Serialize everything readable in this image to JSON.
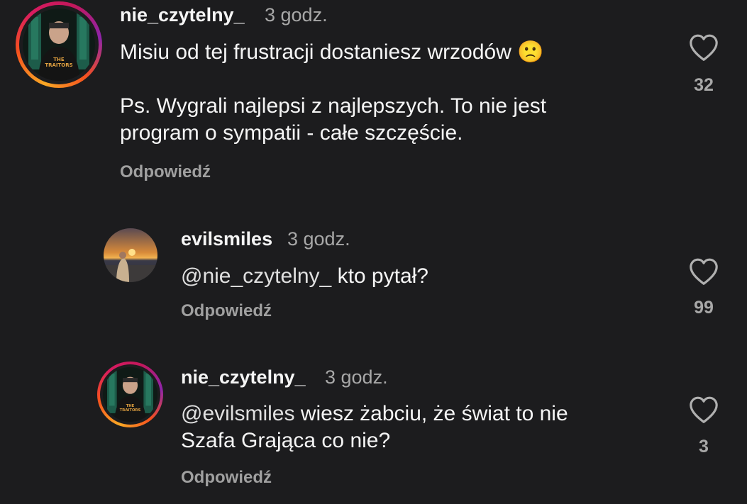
{
  "comments": [
    {
      "username": "nie_czytelny_",
      "time": "3 godz.",
      "text_line1": "Misiu od tej frustracji dostaniesz wrzodów 🙁",
      "text_line2": "Ps. Wygrali najlepsi z najlepszych. To nie jest",
      "text_line3": "program o sympatii - całe szczęście.",
      "reply_label": "Odpowiedź",
      "likes": "32",
      "avatar_text": "THE TRAITORS"
    },
    {
      "username": "evilsmiles",
      "time": "3 godz.",
      "mention": "@nie_czytelny_",
      "text": " kto pytał?",
      "reply_label": "Odpowiedź",
      "likes": "99"
    },
    {
      "username": "nie_czytelny_",
      "time": "3 godz.",
      "mention": "@evilsmiles",
      "text_line1": " wiesz żabciu, że świat to nie",
      "text_line2": "Szafa Grająca co nie?",
      "reply_label": "Odpowiedź",
      "likes": "3",
      "avatar_text": "THE TRAITORS"
    }
  ],
  "colors": {
    "background": "#1c1c1e",
    "text": "#f5f5f5",
    "muted": "#a8a8a8",
    "story_ring": [
      "#f9a825",
      "#d81b60",
      "#8e24aa"
    ]
  },
  "icons": {
    "like": "heart-outline-icon"
  }
}
